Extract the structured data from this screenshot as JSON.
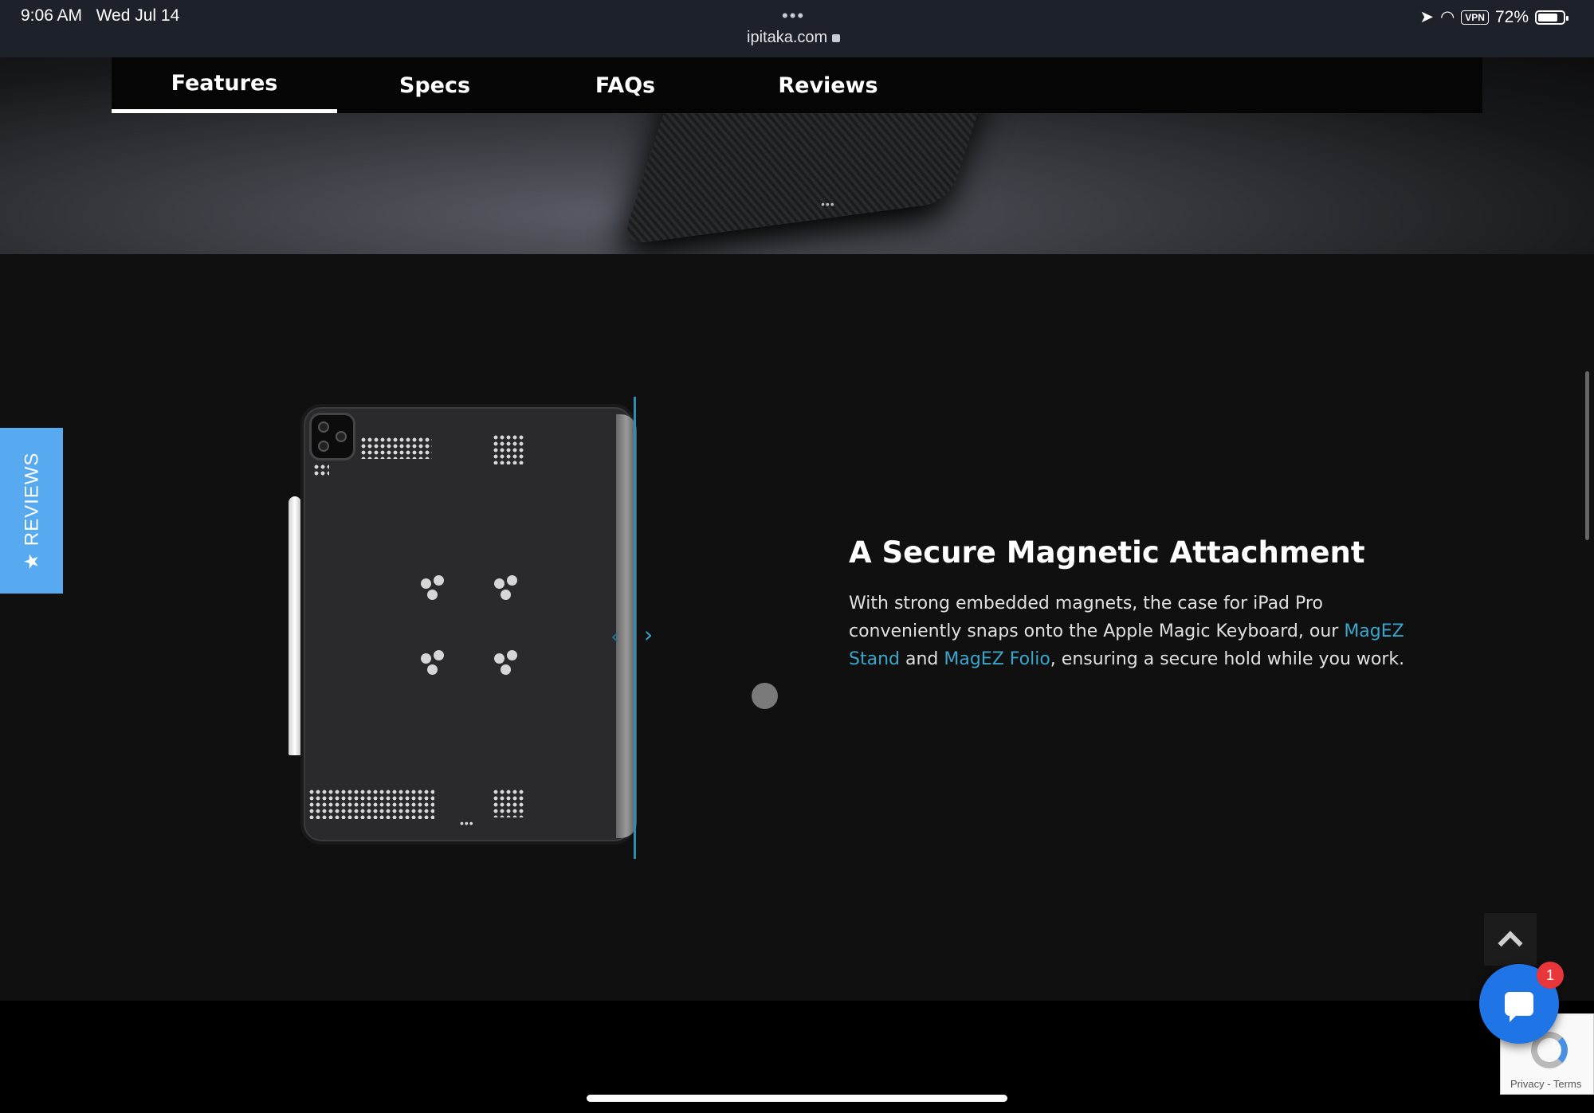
{
  "status_bar": {
    "time": "9:06 AM",
    "date": "Wed Jul 14",
    "url": "ipitaka.com",
    "vpn": "VPN",
    "battery": "72%",
    "battery_level": 0.72
  },
  "nav": {
    "tabs": [
      {
        "label": "Features",
        "active": true
      },
      {
        "label": "Specs",
        "active": false
      },
      {
        "label": "FAQs",
        "active": false
      },
      {
        "label": "Reviews",
        "active": false
      }
    ]
  },
  "reviews_tab": {
    "label": "★ REVIEWS",
    "color": "#57a9f0"
  },
  "feature": {
    "title": "A Secure Magnetic Attachment",
    "text_1": "With strong embedded magnets, the case for iPad Pro conveniently snaps onto the Apple Magic Keyboard, our ",
    "link_1": "MagEZ Stand",
    "text_2": " and ",
    "link_2": "MagEZ Folio",
    "text_3": ", ensuring a secure hold while you work.",
    "link_color": "#3aa6c9"
  },
  "chat": {
    "badge_count": "1",
    "color": "#1f74e6"
  },
  "recaptcha": {
    "text": "Privacy - Terms"
  }
}
